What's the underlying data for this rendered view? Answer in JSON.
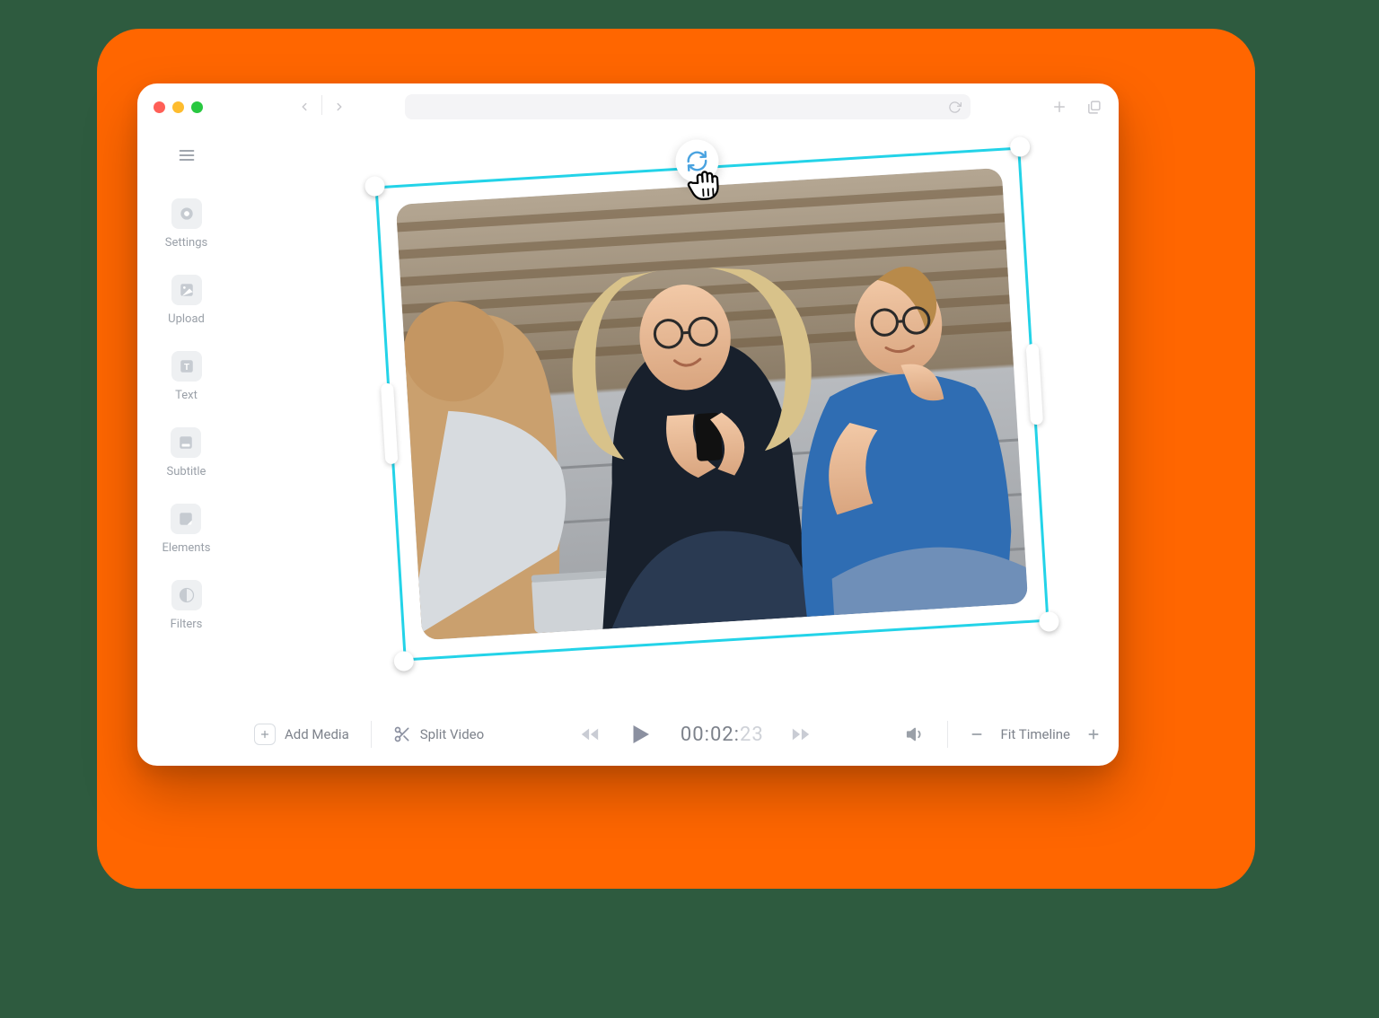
{
  "sidebar": {
    "items": [
      {
        "label": "Settings"
      },
      {
        "label": "Upload"
      },
      {
        "label": "Text"
      },
      {
        "label": "Subtitle"
      },
      {
        "label": "Elements"
      },
      {
        "label": "Filters"
      }
    ]
  },
  "toolbar": {
    "add_media": "Add Media",
    "split_video": "Split Video",
    "fit_timeline": "Fit Timeline"
  },
  "playback": {
    "time_main": "00:02:",
    "time_frames": "23"
  },
  "colors": {
    "accent_orange": "#ff6600",
    "selection_cyan": "#23d3e8"
  }
}
